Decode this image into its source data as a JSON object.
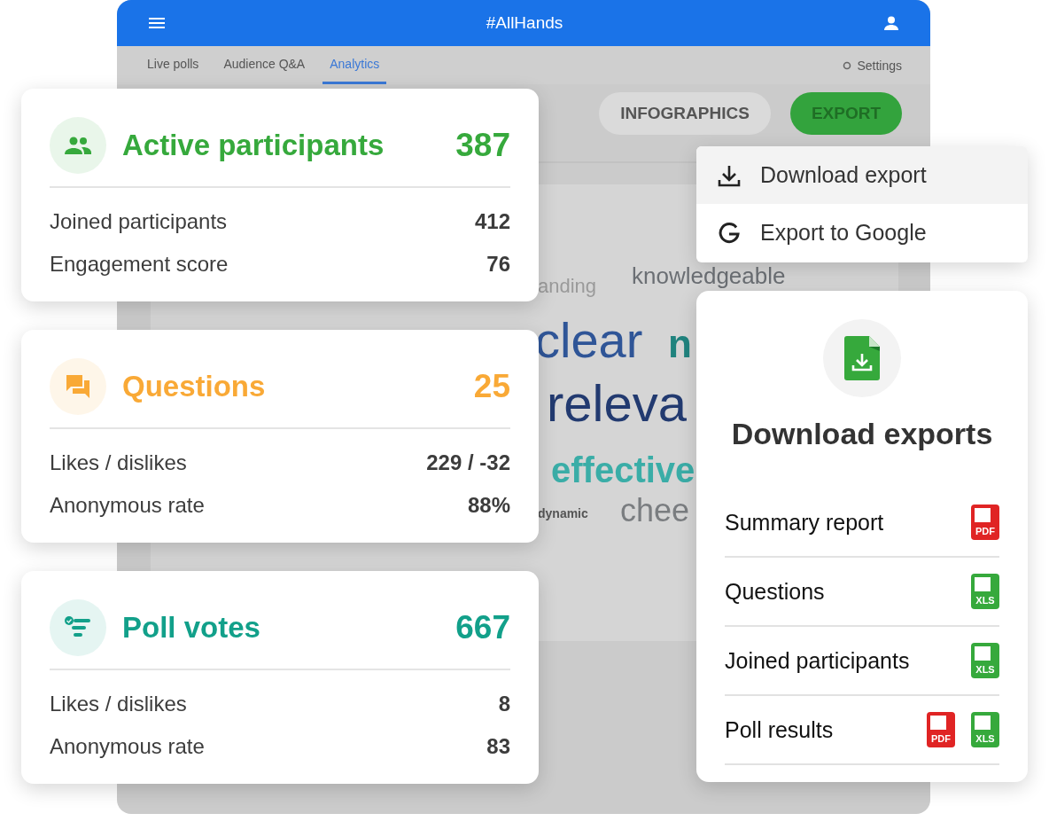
{
  "app_bar": {
    "title": "#AllHands"
  },
  "tabs": [
    {
      "label": "Live polls",
      "selected": false
    },
    {
      "label": "Audience Q&A",
      "selected": false
    },
    {
      "label": "Analytics",
      "selected": true
    }
  ],
  "settings": {
    "label": "Settings"
  },
  "actions": [
    {
      "label": "INFOGRAPHICS",
      "kind": "outlined"
    },
    {
      "label": "EXPORT",
      "kind": "primary"
    }
  ],
  "word_cloud": [
    {
      "text": "anding",
      "color": "#9a9a9a"
    },
    {
      "text": "knowledgeable",
      "color": "#6b6f74"
    },
    {
      "text": "clear",
      "color": "#2f5597"
    },
    {
      "text": "n",
      "color": "#20837e"
    },
    {
      "text": "releva",
      "color": "#223a70"
    },
    {
      "text": "effective",
      "color": "#3aada7"
    },
    {
      "text": "dynamic",
      "color": "#555555"
    },
    {
      "text": "chee",
      "color": "#7a7d80"
    }
  ],
  "stat_cards": [
    {
      "kind": "participants",
      "title": "Active participants",
      "value": "387",
      "color": "#36a93c",
      "rows": [
        {
          "label": "Joined participants",
          "value": "412"
        },
        {
          "label": "Engagement score",
          "value": "76"
        }
      ]
    },
    {
      "kind": "questions",
      "title": "Questions",
      "value": "25",
      "color": "#f9a936",
      "rows": [
        {
          "label": "Likes / dislikes",
          "value": "229 / -32"
        },
        {
          "label": "Anonymous rate",
          "value": "88%"
        }
      ]
    },
    {
      "kind": "polls",
      "title": "Poll votes",
      "value": "667",
      "color": "#12a08a",
      "rows": [
        {
          "label": "Likes / dislikes",
          "value": "8"
        },
        {
          "label": "Anonymous rate",
          "value": "83"
        }
      ]
    }
  ],
  "export_menu": [
    {
      "kind": "download",
      "label": "Download export",
      "selected": true
    },
    {
      "kind": "google",
      "label": "Export to Google",
      "selected": false
    }
  ],
  "downloads": {
    "title": "Download exports",
    "items": [
      {
        "label": "Summary report",
        "files": [
          {
            "kind": "pdf",
            "label": "PDF"
          }
        ]
      },
      {
        "label": "Questions",
        "files": [
          {
            "kind": "xls",
            "label": "XLS"
          }
        ]
      },
      {
        "label": "Joined participants",
        "files": [
          {
            "kind": "xls",
            "label": "XLS"
          }
        ]
      },
      {
        "label": "Poll results",
        "files": [
          {
            "kind": "pdf",
            "label": "PDF"
          },
          {
            "kind": "xls",
            "label": "XLS"
          }
        ]
      }
    ]
  }
}
